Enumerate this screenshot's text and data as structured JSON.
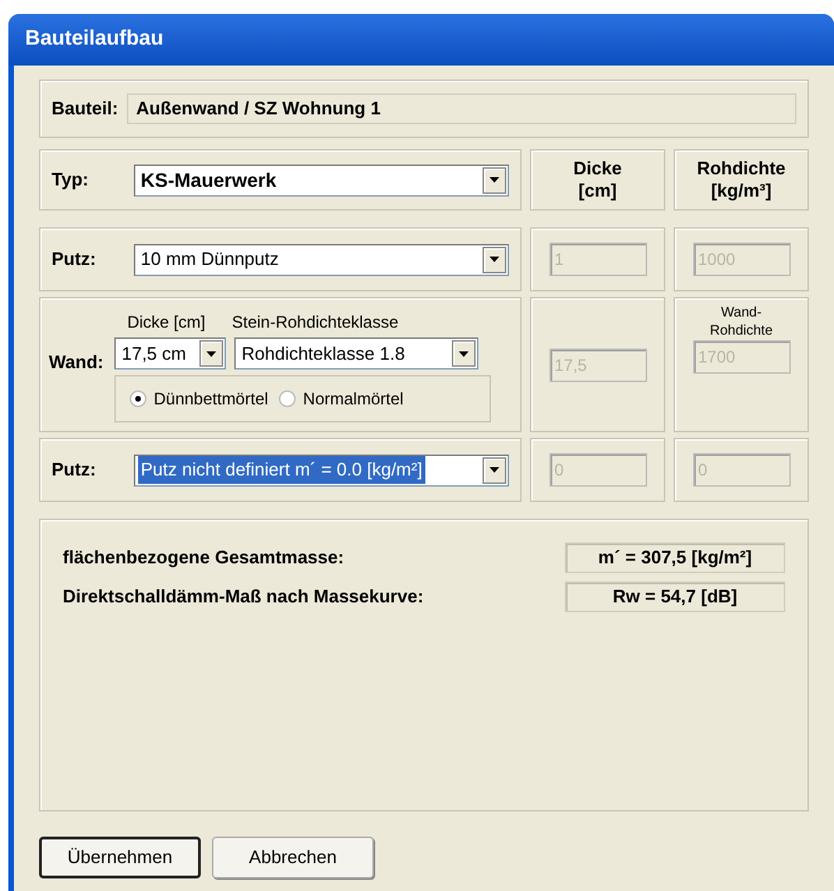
{
  "window": {
    "title": "Bauteilaufbau"
  },
  "bauteil": {
    "label": "Bauteil:",
    "value": "Außenwand / SZ Wohnung 1"
  },
  "header": {
    "typ_label": "Typ:",
    "typ_value": "KS-Mauerwerk",
    "dicke": [
      "Dicke",
      "[cm]"
    ],
    "rohdichte": [
      "Rohdichte",
      "[kg/m³]"
    ]
  },
  "layers": [
    {
      "kind": "putz",
      "label": "Putz:",
      "value": "10 mm Dünnputz",
      "highlighted": false,
      "dicke": "1",
      "rohdichte": "1000"
    },
    {
      "kind": "wand",
      "label": "Wand:",
      "dicke_label": "Dicke [cm]",
      "dicke_value": "17,5 cm",
      "klasse_label": "Stein-Rohdichteklasse",
      "klasse_value": "Rohdichteklasse  1.8",
      "mortar": [
        {
          "label": "Dünnbettmörtel",
          "selected": true
        },
        {
          "label": "Normalmörtel",
          "selected": false
        }
      ],
      "dicke": "17,5",
      "rohdichte_label": [
        "Wand-",
        "Rohdichte"
      ],
      "rohdichte": "1700"
    },
    {
      "kind": "putz",
      "label": "Putz:",
      "value": "Putz nicht definiert m´ = 0.0 [kg/m²]",
      "highlighted": true,
      "dicke": "0",
      "rohdichte": "0"
    }
  ],
  "results": [
    {
      "label": "flächenbezogene Gesamtmasse:",
      "value": "m´ = 307,5 [kg/m²]"
    },
    {
      "label": "Direktschalldämm-Maß nach Massekurve:",
      "value": "Rw = 54,7 [dB]"
    }
  ],
  "buttons": [
    {
      "label": "Übernehmen",
      "default": true
    },
    {
      "label": "Abbrechen",
      "default": false
    }
  ]
}
